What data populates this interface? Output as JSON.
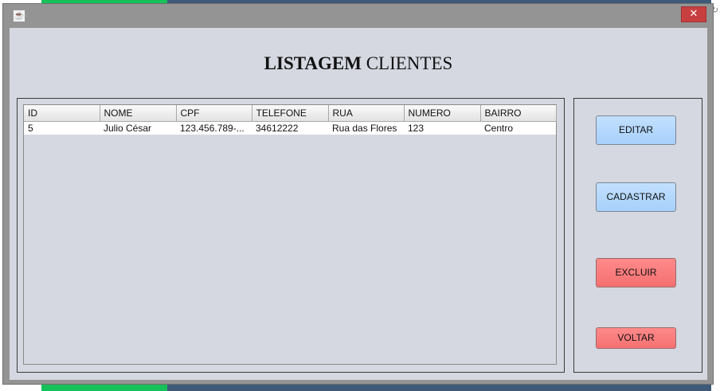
{
  "window": {
    "close_glyph": "✕",
    "app_icon": "java-icon"
  },
  "page": {
    "title_bold": "LISTAGEM",
    "title_rest": " CLIENTES"
  },
  "table": {
    "columns": [
      "ID",
      "NOME",
      "CPF",
      "TELEFONE",
      "RUA",
      "NUMERO",
      "BAIRRO"
    ],
    "rows": [
      [
        "5",
        "Julio César",
        "123.456.789-...",
        "34612222",
        "Rua das Flores",
        "123",
        "Centro"
      ]
    ]
  },
  "buttons": {
    "editar": "EDITAR",
    "cadastrar": "CADASTRAR",
    "excluir": "EXCLUIR",
    "voltar": "VOLTAR"
  },
  "colors": {
    "button_blue": "#b4d8ff",
    "button_red": "#f87a7a",
    "panel_bg": "#d5d8e0"
  },
  "background": {
    "edge_glyph": "↻"
  }
}
